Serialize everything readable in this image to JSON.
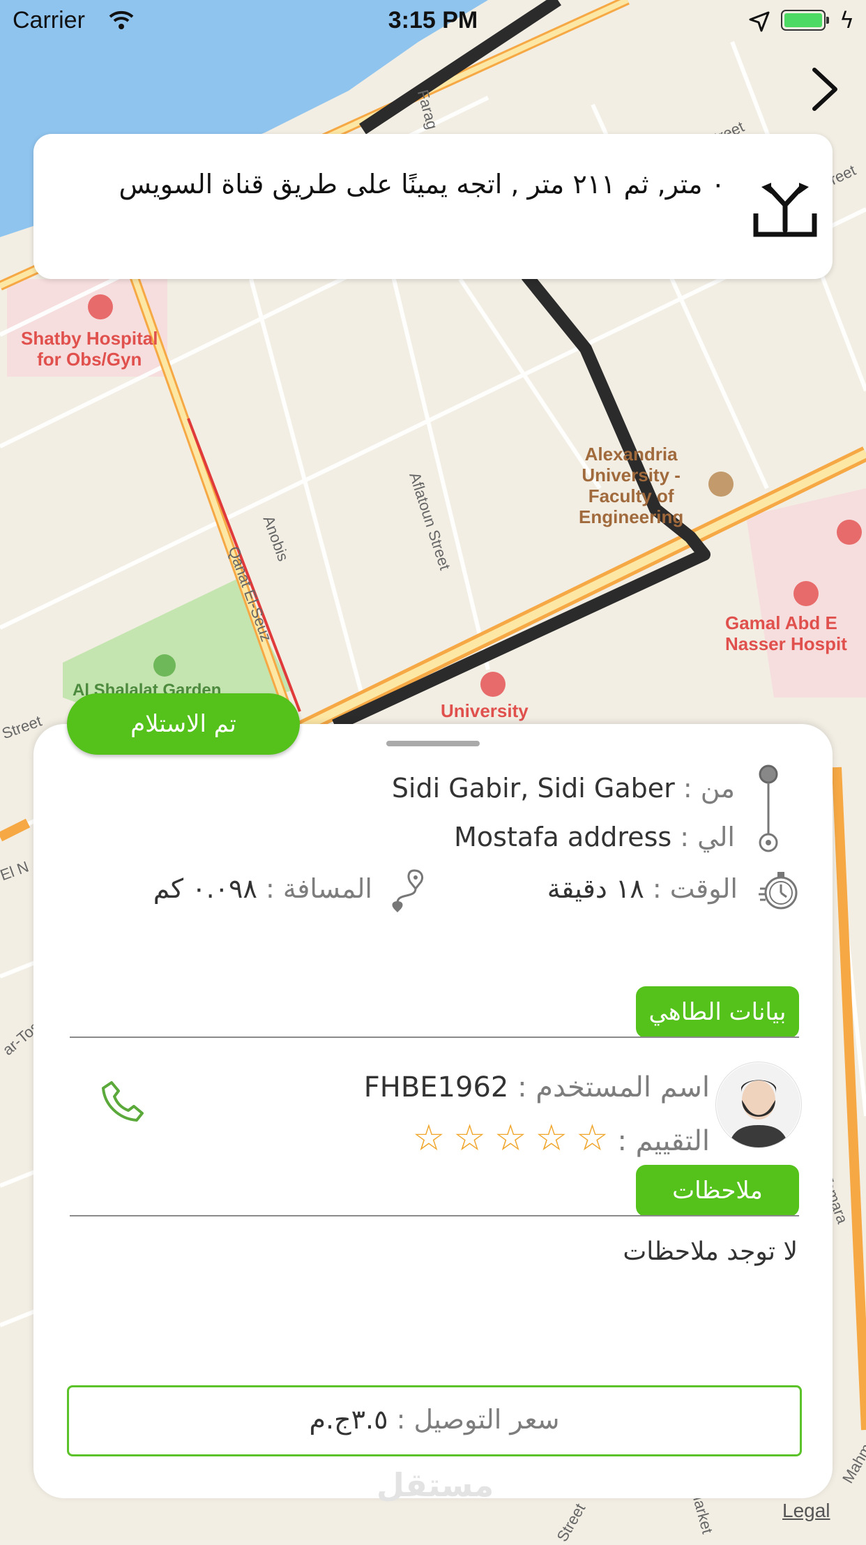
{
  "status_bar": {
    "carrier": "Carrier",
    "time": "3:15 PM"
  },
  "map": {
    "labels": {
      "farag": "Farag",
      "street_top": "Street",
      "street_right": "reet",
      "hospital_shatby": "Shatby Hospital\nfor Obs/Gyn",
      "alex_university": "Alexandria\nUniversity -\nFaculty of\nEngineering",
      "gamal_hospital": "Gamal Abd E\nNasser Hospit",
      "university": "University",
      "garden": "Al Shalalat Garden",
      "anobis": "Anobis",
      "aflatoun": "Aflatoun Street",
      "qanat": "Qanat El-Seuz",
      "street_left": "Street",
      "el_n": "El N",
      "ar_tos": "ar-Tos",
      "tomara": "Tomara",
      "mahmo": "Mahmo",
      "street_bottom": "Street",
      "market": "Market"
    },
    "legal": "Legal"
  },
  "instruction": {
    "text": "٠ متر,  ثم  ٢١١ متر  , اتجه يمينًا على طريق قناة السويس",
    "icon": "turn-icon"
  },
  "pickup_button": "تم الاستلام",
  "trip": {
    "from_label": "من :",
    "from_value": "Sidi Gabir, Sidi Gaber",
    "to_label": "الي :",
    "to_value": "Mostafa address",
    "time_label": "الوقت :",
    "time_value": "١٨ دقيقة",
    "distance_label": "المسافة :",
    "distance_value": "٠.٠٩٨ كم"
  },
  "chef_section": {
    "title": "بيانات الطاهي",
    "username_label": "اسم المستخدم :",
    "username_value": "FHBE1962",
    "rating_label": "التقييم :",
    "rating": 0,
    "rating_max": 5
  },
  "notes_section": {
    "title": "ملاحظات",
    "text": "لا توجد ملاحظات"
  },
  "price": {
    "label": "سعر التوصيل :",
    "value": "٣.٥ج.م"
  },
  "watermark": "مستقل",
  "colors": {
    "accent_green": "#55c21b",
    "route": "#2b2b2b",
    "star": "#f0a52b",
    "water": "#8fc4ee"
  }
}
